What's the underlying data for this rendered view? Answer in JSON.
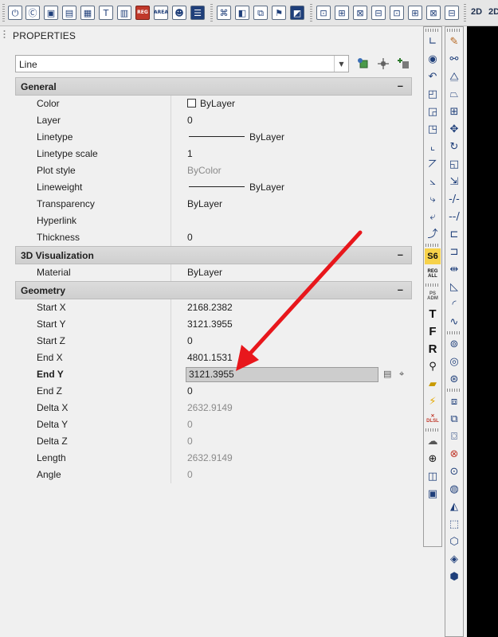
{
  "toolbar": {
    "icons": [
      "fence-icon",
      "purge-icon",
      "layer-states-icon",
      "layer-match-icon",
      "layer-iso-icon",
      "text-style-icon",
      "table-icon",
      "reg-icon",
      "area-icon",
      "group-icon",
      "color-bars-icon",
      "mesh-icon",
      "box-icon",
      "door-icon",
      "flag-icon",
      "window-icon",
      "frame-a-icon",
      "frame-b-icon",
      "frame-c-icon",
      "frame-d-icon",
      "frame-e-icon",
      "frame-f-icon",
      "frame-g-icon"
    ],
    "reg_label": "REG",
    "area_label": "AREA",
    "view_2d": "2D",
    "view_2d_b": "2D"
  },
  "palette": {
    "title": "PROPERTIES",
    "object_type": "Line",
    "header_buttons": [
      "quick-select-icon",
      "select-objects-icon",
      "toggle-pickadd-icon"
    ]
  },
  "sections": {
    "general": {
      "title": "General",
      "toggle": "–",
      "rows": [
        {
          "label": "Color",
          "value": "ByLayer"
        },
        {
          "label": "Layer",
          "value": "0"
        },
        {
          "label": "Linetype",
          "value": "ByLayer"
        },
        {
          "label": "Linetype scale",
          "value": "1"
        },
        {
          "label": "Plot style",
          "value": "ByColor"
        },
        {
          "label": "Lineweight",
          "value": "ByLayer"
        },
        {
          "label": "Transparency",
          "value": "ByLayer"
        },
        {
          "label": "Hyperlink",
          "value": ""
        },
        {
          "label": "Thickness",
          "value": "0"
        }
      ]
    },
    "visualization": {
      "title": "3D Visualization",
      "toggle": "–",
      "rows": [
        {
          "label": "Material",
          "value": "ByLayer"
        }
      ]
    },
    "geometry": {
      "title": "Geometry",
      "toggle": "–",
      "rows": [
        {
          "label": "Start X",
          "value": "2168.2382"
        },
        {
          "label": "Start Y",
          "value": "3121.3955"
        },
        {
          "label": "Start Z",
          "value": "0"
        },
        {
          "label": "End X",
          "value": "4801.1531"
        },
        {
          "label": "End Y",
          "value": "3121.3955"
        },
        {
          "label": "End Z",
          "value": "0"
        },
        {
          "label": "Delta X",
          "value": "2632.9149"
        },
        {
          "label": "Delta Y",
          "value": "0"
        },
        {
          "label": "Delta Z",
          "value": "0"
        },
        {
          "label": "Length",
          "value": "2632.9149"
        },
        {
          "label": "Angle",
          "value": "0"
        }
      ]
    }
  },
  "right_toolbar_1": {
    "icons": [
      "ucs-icon",
      "ucs-world-icon",
      "ucs-previous-icon",
      "ucs-face-icon",
      "ucs-object-icon",
      "ucs-view-icon",
      "ucs-origin-icon",
      "ucs-zaxis-icon",
      "ucs-3point-icon",
      "ucs-x-icon",
      "ucs-y-icon",
      "ucs-z-icon"
    ],
    "s6_label": "S6",
    "regall_label_1": "REG",
    "regall_label_2": "ALL",
    "psadm_label_1": "PS",
    "psadm_label_2": "ADM",
    "text_t_label": "T",
    "text_f_label": "F",
    "text_r_label": "R",
    "extra_icons": [
      "zoom-icon",
      "field-icon",
      "lightning-icon",
      "delete-sel-icon",
      "cloud-icon",
      "target-icon",
      "column-icon",
      "cube-icon"
    ],
    "delsel_label": "DLSL"
  },
  "right_toolbar_2": {
    "icons": [
      "pencil-icon",
      "move-copy-icon",
      "mirror-icon",
      "offset-icon",
      "array-icon",
      "move-icon",
      "rotate-icon",
      "scale-icon",
      "stretch-icon",
      "trim-icon",
      "extend-icon",
      "break-icon",
      "join-icon",
      "chamfer-icon",
      "fillet-icon",
      "spline-icon",
      "union-icon",
      "subtract-icon",
      "intersect-icon",
      "box3d-icon",
      "wedge-icon",
      "cylinder-icon",
      "cone-icon",
      "sphere-icon",
      "torus-icon",
      "pyramid-icon",
      "loft-icon",
      "shell-icon",
      "copy-3d-icon",
      "extrude-icon"
    ]
  },
  "annotation": {
    "arrow_color": "#e8171c"
  }
}
